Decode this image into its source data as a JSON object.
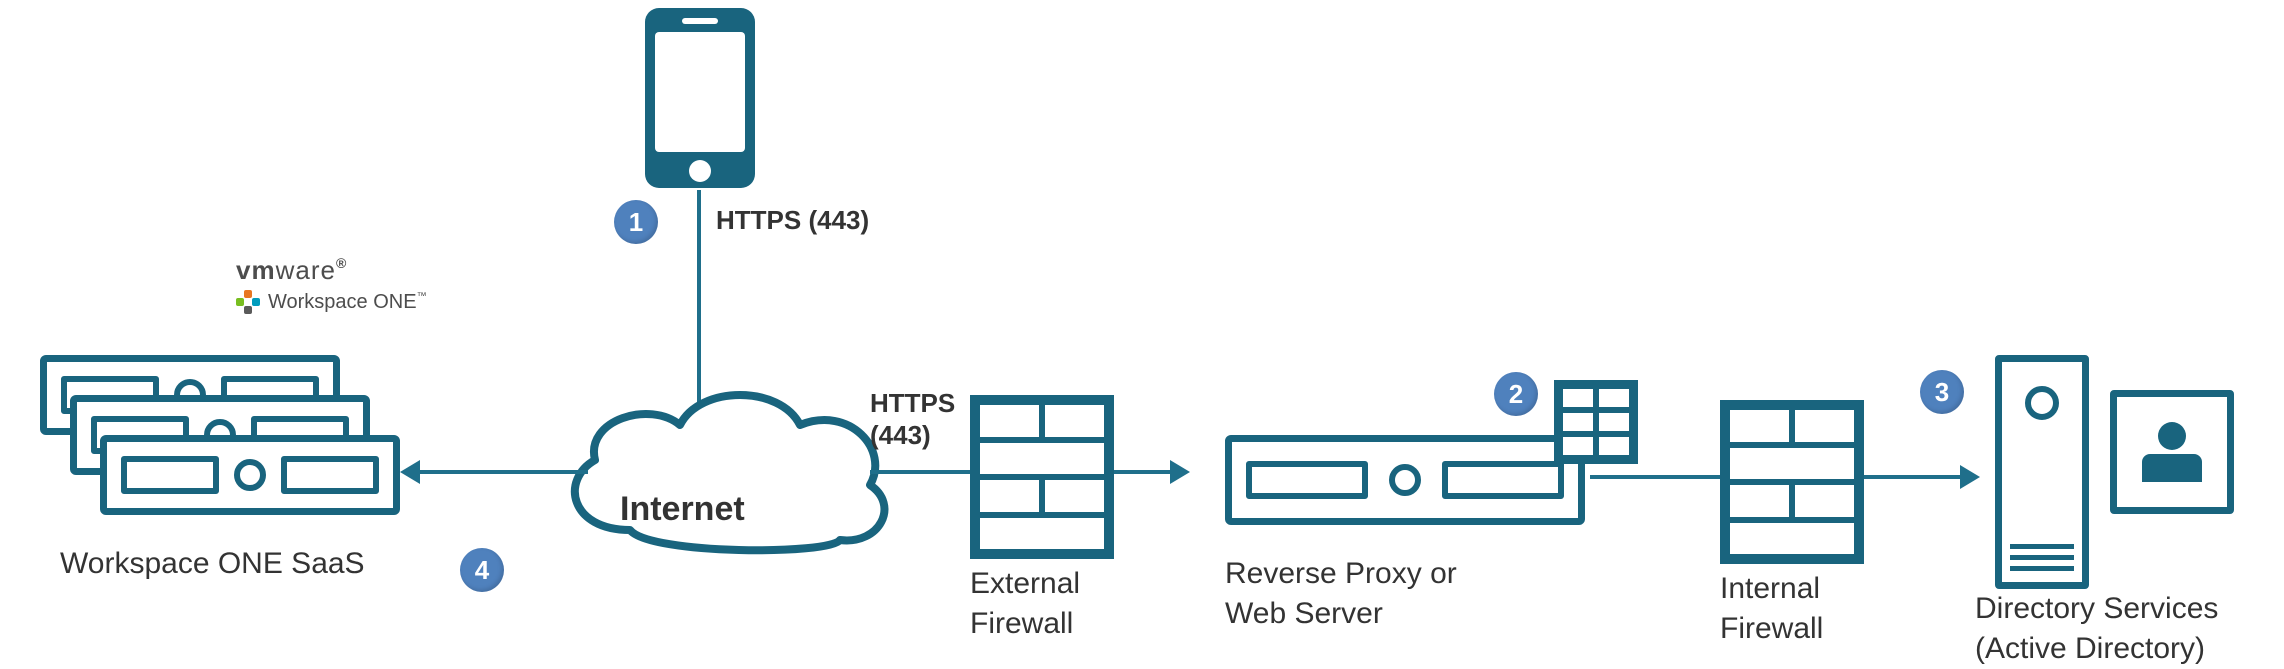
{
  "logo": {
    "brand_strong": "vm",
    "brand_light": "ware",
    "reg": "®",
    "product": "Workspace ONE",
    "tm": "™"
  },
  "badges": {
    "n1": "1",
    "n2": "2",
    "n3": "3",
    "n4": "4"
  },
  "protocols": {
    "phone_to_internet": "HTTPS (443)",
    "internet_to_fw_line1": "HTTPS",
    "internet_to_fw_line2": "(443)"
  },
  "cloud": {
    "label": "Internet"
  },
  "nodes": {
    "saas": "Workspace ONE SaaS",
    "ext_fw_l1": "External",
    "ext_fw_l2": "Firewall",
    "revproxy_l1": "Reverse Proxy or",
    "revproxy_l2": "Web Server",
    "int_fw_l1": "Internal",
    "int_fw_l2": "Firewall",
    "dir_l1": "Directory Services",
    "dir_l2": "(Active Directory)"
  }
}
